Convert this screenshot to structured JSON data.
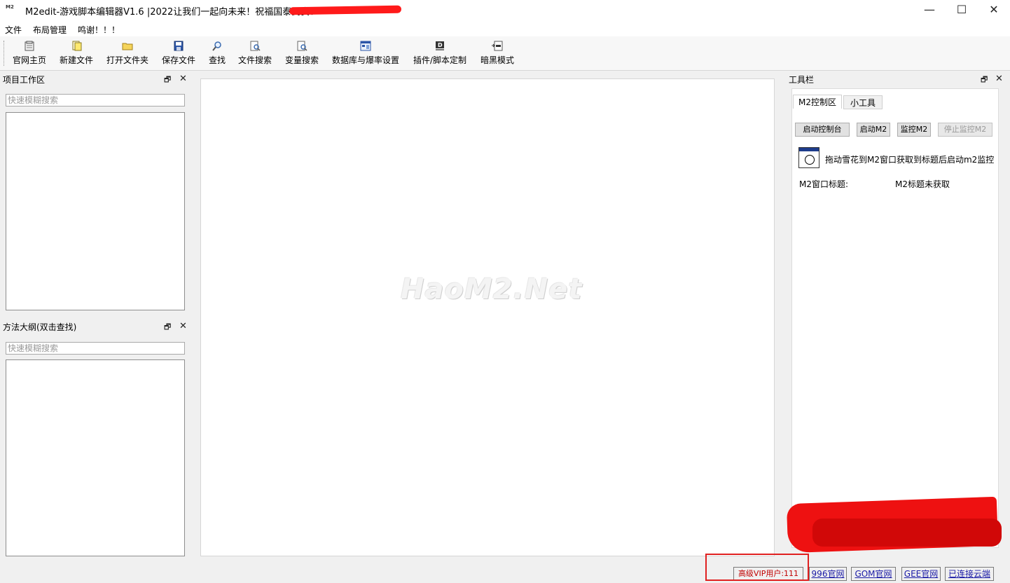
{
  "window": {
    "title": "M2edit-游戏脚本编辑器V1.6 |2022让我们一起向未来！祝福国泰民安！",
    "icon_text": "M2",
    "controls": {
      "minimize": "—",
      "maximize": "☐",
      "close": "✕"
    }
  },
  "menu": [
    "文件",
    "布局管理",
    "鸣谢！！！"
  ],
  "toolbar": [
    {
      "label": "官网主页",
      "icon": "home-page-icon"
    },
    {
      "label": "新建文件",
      "icon": "new-file-icon"
    },
    {
      "label": "打开文件夹",
      "icon": "open-folder-icon"
    },
    {
      "label": "保存文件",
      "icon": "save-icon"
    },
    {
      "label": "查找",
      "icon": "search-icon"
    },
    {
      "label": "文件搜索",
      "icon": "file-search-icon"
    },
    {
      "label": "变量搜索",
      "icon": "variable-search-icon"
    },
    {
      "label": "数据库与爆率设置",
      "icon": "database-icon"
    },
    {
      "label": "插件/脚本定制",
      "icon": "plugin-icon"
    },
    {
      "label": "暗黑模式",
      "icon": "dark-mode-icon"
    }
  ],
  "project_panel": {
    "title": "项目工作区",
    "search_placeholder": "快速模糊搜索"
  },
  "outline_panel": {
    "title": "方法大纲(双击查找)",
    "search_placeholder": "快速模糊搜索"
  },
  "editor": {
    "watermark": "HaoM2.Net"
  },
  "tool_panel": {
    "title": "工具栏",
    "tabs": [
      "M2控制区",
      "小工具"
    ],
    "buttons": {
      "start_console": "启动控制台",
      "start_m2": "启动M2",
      "monitor_m2": "监控M2",
      "stop_monitor": "停止监控M2"
    },
    "drag_hint": "拖动雪花到M2窗口获取到标题后启动m2监控",
    "window_title_label": "M2窗口标题:",
    "window_title_value": "M2标题未获取"
  },
  "panel_icons": {
    "pin": "🗗",
    "close": "✕"
  },
  "status_bar": {
    "vip": "高级VIP用户:111",
    "links": [
      "996官网",
      "GOM官网",
      "GEE官网",
      "已连接云端"
    ]
  },
  "colors": {
    "redaction": "#ff1a1a",
    "vip_text": "#c00000",
    "link": "#1a1aa6"
  }
}
